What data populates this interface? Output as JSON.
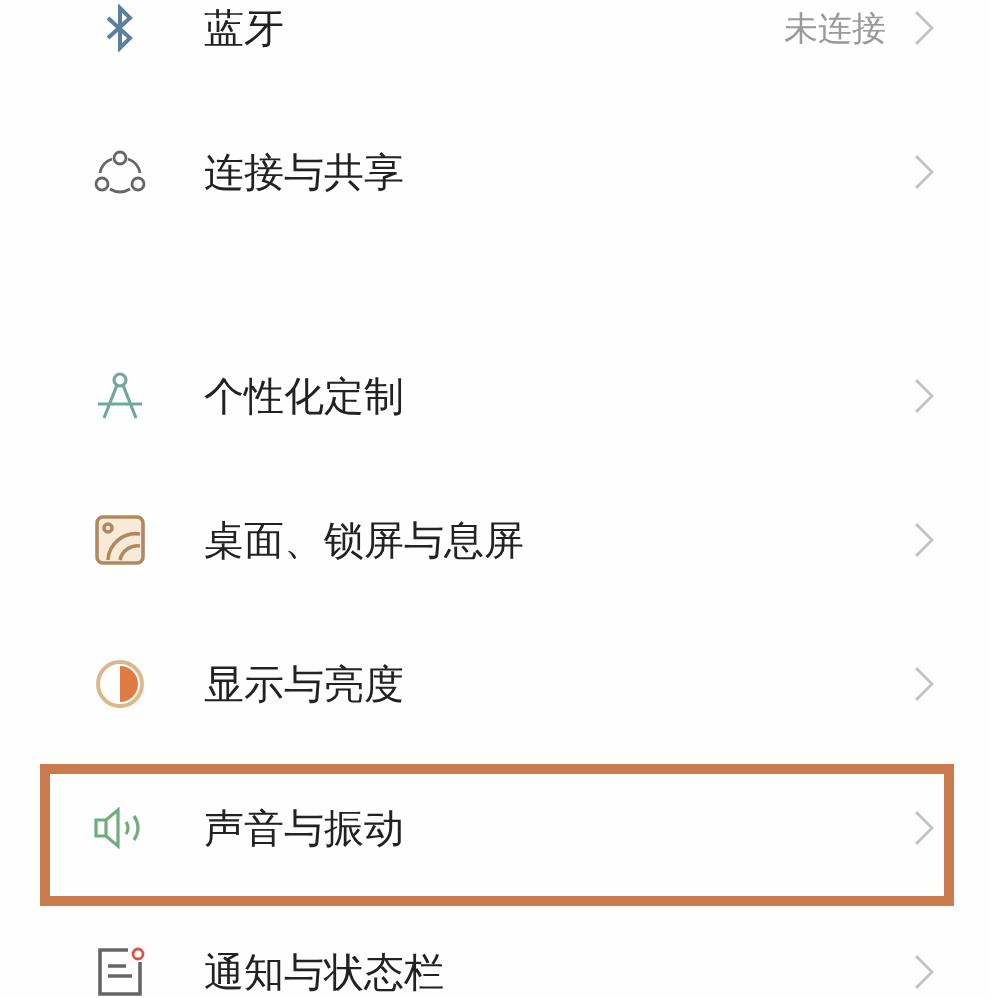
{
  "groups": [
    {
      "items": [
        {
          "kind": "bluetooth",
          "label": "蓝牙",
          "value": "未连接",
          "highlighted": false
        },
        {
          "kind": "share",
          "label": "连接与共享",
          "highlighted": false
        }
      ]
    },
    {
      "items": [
        {
          "kind": "personalize",
          "label": "个性化定制",
          "highlighted": false
        },
        {
          "kind": "wallpaper",
          "label": "桌面、锁屏与息屏",
          "highlighted": false
        },
        {
          "kind": "display",
          "label": "显示与亮度",
          "highlighted": false
        },
        {
          "kind": "sound",
          "label": "声音与振动",
          "highlighted": true
        },
        {
          "kind": "notification",
          "label": "通知与状态栏",
          "highlighted": false
        }
      ]
    }
  ]
}
